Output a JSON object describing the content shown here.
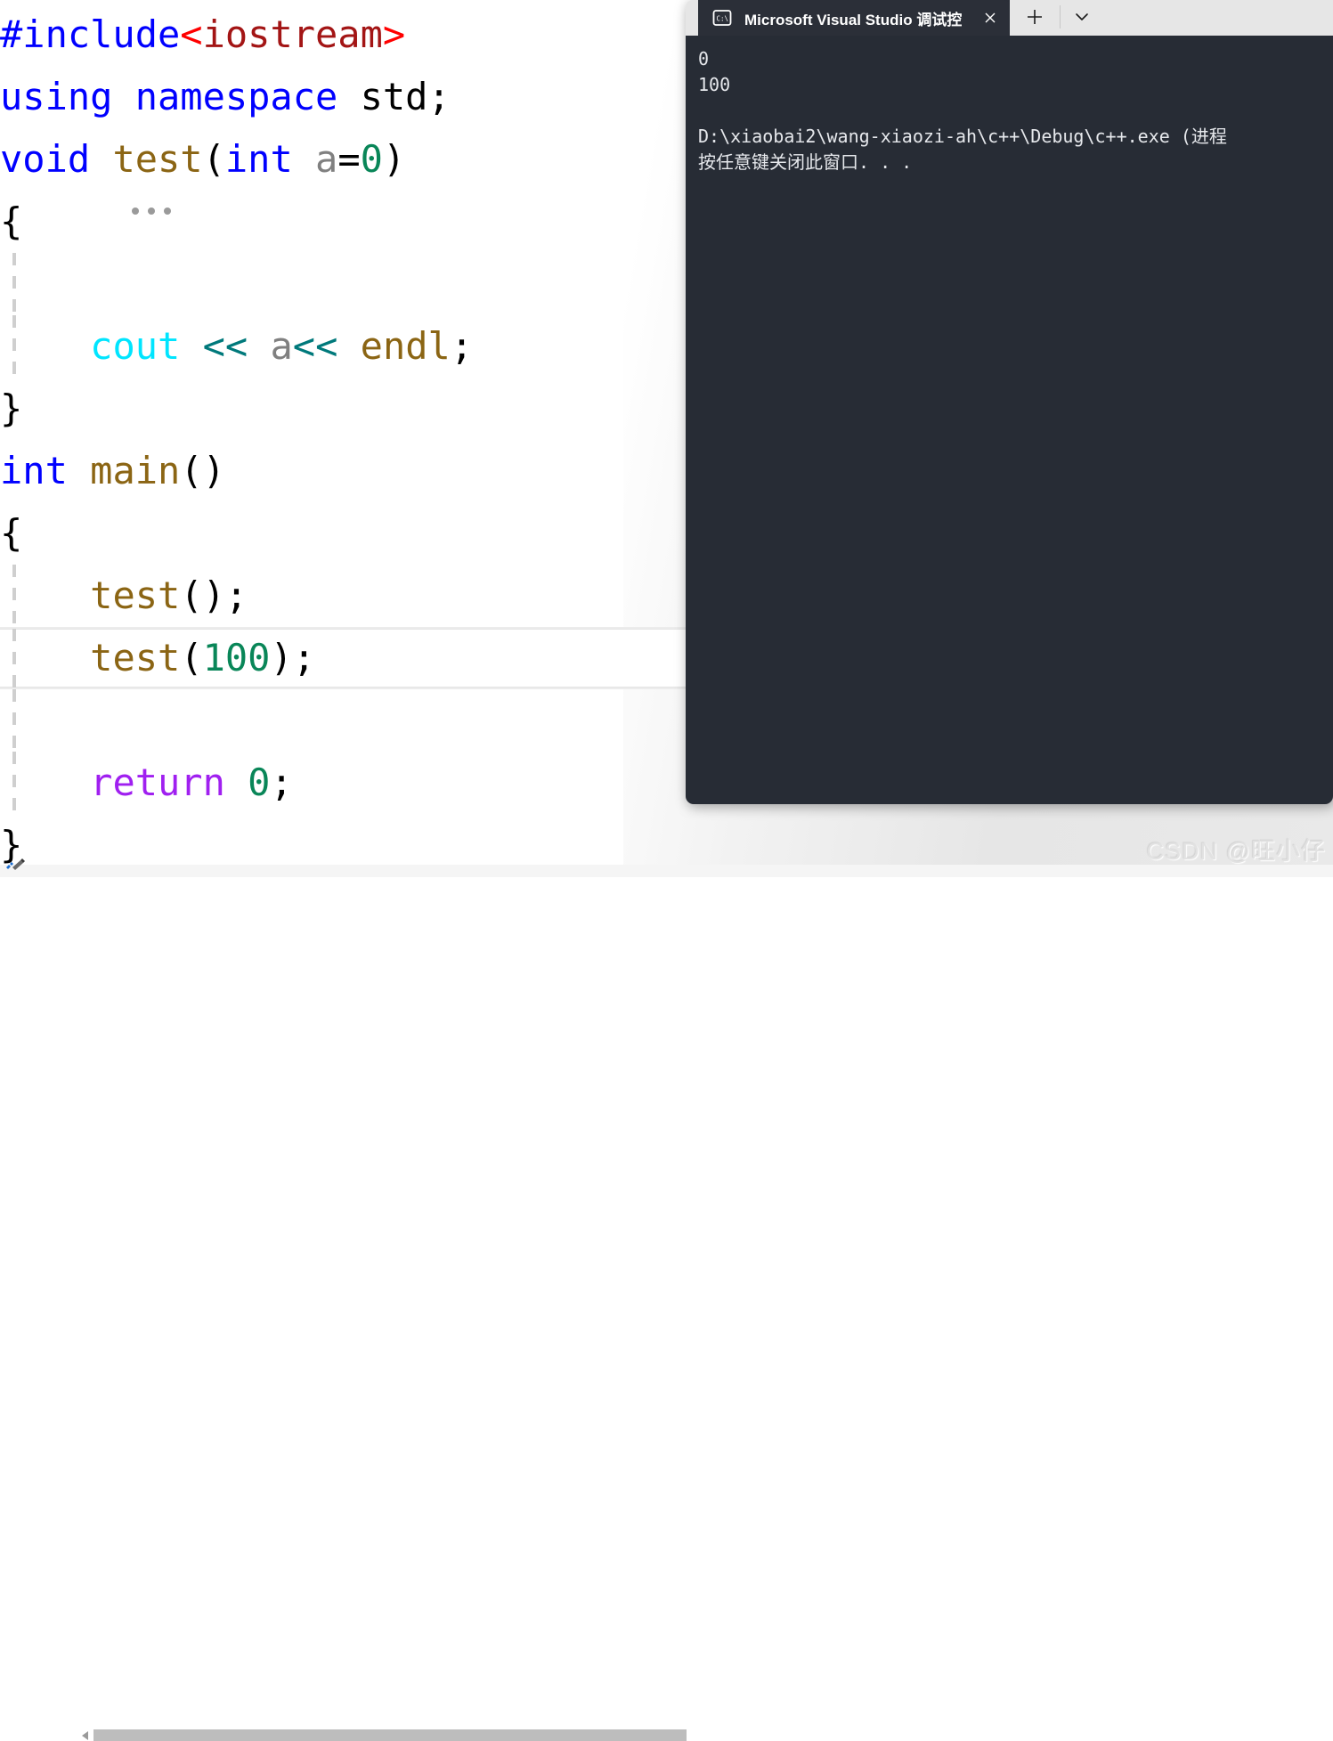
{
  "editor": {
    "language": "cpp",
    "background": "#ffffff",
    "current_line_index": 10,
    "code_lines": [
      {
        "indent_guide": false,
        "tokens": [
          {
            "t": "#include",
            "c": "kw"
          },
          {
            "t": "<",
            "c": "angle"
          },
          {
            "t": "iostream",
            "c": "pp-str"
          },
          {
            "t": ">",
            "c": "angle"
          }
        ]
      },
      {
        "indent_guide": false,
        "tokens": [
          {
            "t": "using namespace ",
            "c": "kw"
          },
          {
            "t": "std;",
            "c": "plain"
          }
        ]
      },
      {
        "indent_guide": false,
        "rename_dots": true,
        "tokens": [
          {
            "t": "void ",
            "c": "kw"
          },
          {
            "t": "test",
            "c": "fn"
          },
          {
            "t": "(",
            "c": "plain"
          },
          {
            "t": "int ",
            "c": "kw"
          },
          {
            "t": "a",
            "c": "param"
          },
          {
            "t": "=",
            "c": "plain"
          },
          {
            "t": "0",
            "c": "num"
          },
          {
            "t": ")",
            "c": "plain"
          }
        ]
      },
      {
        "indent_guide": false,
        "tokens": [
          {
            "t": "{",
            "c": "plain"
          }
        ]
      },
      {
        "indent_guide": true,
        "tokens": []
      },
      {
        "indent_guide": true,
        "tokens": [
          {
            "t": "    ",
            "c": "plain"
          },
          {
            "t": "cout",
            "c": "obj"
          },
          {
            "t": " ",
            "c": "plain"
          },
          {
            "t": "<<",
            "c": "op-ins"
          },
          {
            "t": " ",
            "c": "plain"
          },
          {
            "t": "a",
            "c": "param"
          },
          {
            "t": "<<",
            "c": "op-ins"
          },
          {
            "t": " ",
            "c": "plain"
          },
          {
            "t": "endl",
            "c": "manip"
          },
          {
            "t": ";",
            "c": "plain"
          }
        ]
      },
      {
        "indent_guide": false,
        "tokens": [
          {
            "t": "}",
            "c": "plain"
          }
        ]
      },
      {
        "indent_guide": false,
        "tokens": [
          {
            "t": "int ",
            "c": "kw"
          },
          {
            "t": "main",
            "c": "fn"
          },
          {
            "t": "()",
            "c": "plain"
          }
        ]
      },
      {
        "indent_guide": false,
        "tokens": [
          {
            "t": "{",
            "c": "plain"
          }
        ]
      },
      {
        "indent_guide": true,
        "tokens": [
          {
            "t": "    ",
            "c": "plain"
          },
          {
            "t": "test",
            "c": "fn"
          },
          {
            "t": "();",
            "c": "plain"
          }
        ]
      },
      {
        "indent_guide": true,
        "current": true,
        "tokens": [
          {
            "t": "    ",
            "c": "plain"
          },
          {
            "t": "test",
            "c": "fn"
          },
          {
            "t": "(",
            "c": "plain"
          },
          {
            "t": "100",
            "c": "num"
          },
          {
            "t": ");",
            "c": "plain"
          }
        ]
      },
      {
        "indent_guide": true,
        "tokens": []
      },
      {
        "indent_guide": true,
        "tokens": [
          {
            "t": "    ",
            "c": "plain"
          },
          {
            "t": "return",
            "c": "ret"
          },
          {
            "t": " ",
            "c": "plain"
          },
          {
            "t": "0",
            "c": "num"
          },
          {
            "t": ";",
            "c": "plain"
          }
        ]
      },
      {
        "indent_guide": false,
        "tokens": [
          {
            "t": "}",
            "c": "plain"
          }
        ]
      }
    ],
    "colors": {
      "keyword": "#0000ff",
      "preprocessor_string": "#a31515",
      "angle_bracket": "#ff0000",
      "function": "#8b6514",
      "parameter": "#808080",
      "number": "#098658",
      "stream_object": "#00e5ff",
      "stream_operator": "#00797b",
      "return_keyword": "#a020f0",
      "plain": "#000000"
    },
    "quick_action_icon": "lightbulb-screwdriver-icon",
    "hscrollbar": {
      "name": "horizontal-scrollbar"
    }
  },
  "console": {
    "tab": {
      "title": "Microsoft Visual Studio 调试控",
      "icon": "console-cmd-icon",
      "close_label": "✕"
    },
    "new_tab_label": "+",
    "dropdown_label": "⌄",
    "background": "#272c35",
    "titlebar_background": "#e6e6e6",
    "output_lines": [
      "0",
      "100",
      "",
      "D:\\xiaobai2\\wang-xiaozi-ah\\c++\\Debug\\c++.exe (进程",
      "按任意键关闭此窗口. . ."
    ]
  },
  "watermark": {
    "text": "CSDN @旺小仔"
  }
}
